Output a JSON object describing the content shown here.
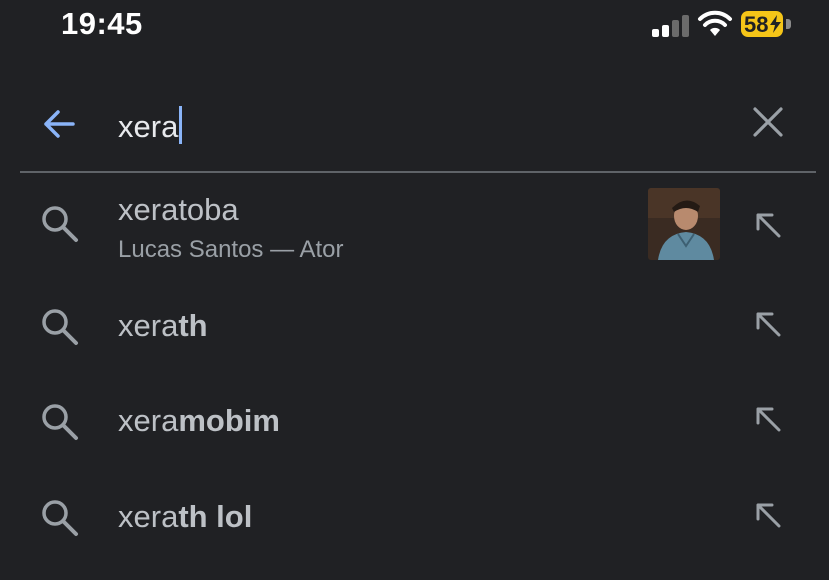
{
  "status_bar": {
    "time": "19:45",
    "battery_percent": "58",
    "battery_color": "#f5c518",
    "icons": [
      "cellular-signal-icon",
      "wifi-icon",
      "battery-charging-icon"
    ]
  },
  "search": {
    "query": "xera",
    "back_icon": "arrow-left-icon",
    "clear_icon": "close-icon",
    "accent_color": "#8ab4f8"
  },
  "suggestions": [
    {
      "typed": "xera",
      "completion": "toba",
      "subtitle": "Lucas Santos — Ator",
      "has_thumbnail": true,
      "icon": "search-icon",
      "action_icon": "arrow-up-left-icon"
    },
    {
      "typed": "xera",
      "completion": "th",
      "icon": "search-icon",
      "action_icon": "arrow-up-left-icon"
    },
    {
      "typed": "xera",
      "completion": "mobim",
      "icon": "search-icon",
      "action_icon": "arrow-up-left-icon"
    },
    {
      "typed": "xera",
      "completion": "th lol",
      "icon": "search-icon",
      "action_icon": "arrow-up-left-icon"
    }
  ]
}
